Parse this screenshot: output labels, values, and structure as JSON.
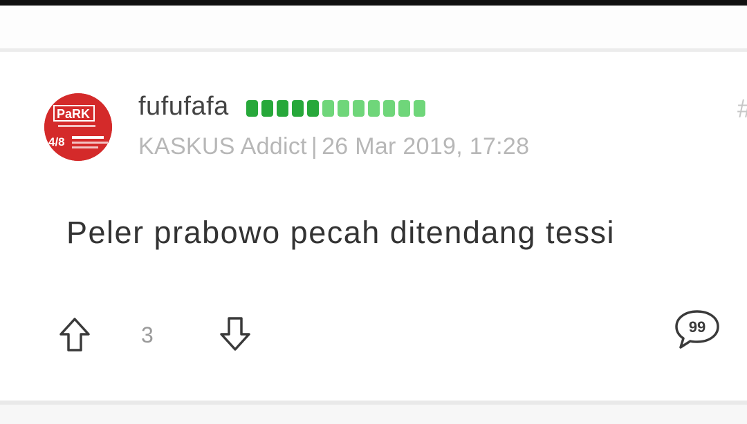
{
  "post": {
    "username": "fufufafa",
    "reputation": {
      "filled": 5,
      "total": 12
    },
    "rank": "KASKUS Addict",
    "separator": "|",
    "timestamp": "26 Mar 2019, 17:28",
    "hash": "#",
    "body": "Peler prabowo pecah ditendang tessi",
    "vote_count": "3",
    "quote_icon_text": "99"
  },
  "avatar": {
    "text_top": "PaRK",
    "text_side": "4/8"
  },
  "colors": {
    "rep_dark": "#27a83a",
    "rep_light": "#6fd67a",
    "avatar_red": "#d42a2a"
  },
  "icons": {
    "upvote": "arrow-up-outline-icon",
    "downvote": "arrow-down-outline-icon",
    "quote": "quote-bubble-icon"
  }
}
